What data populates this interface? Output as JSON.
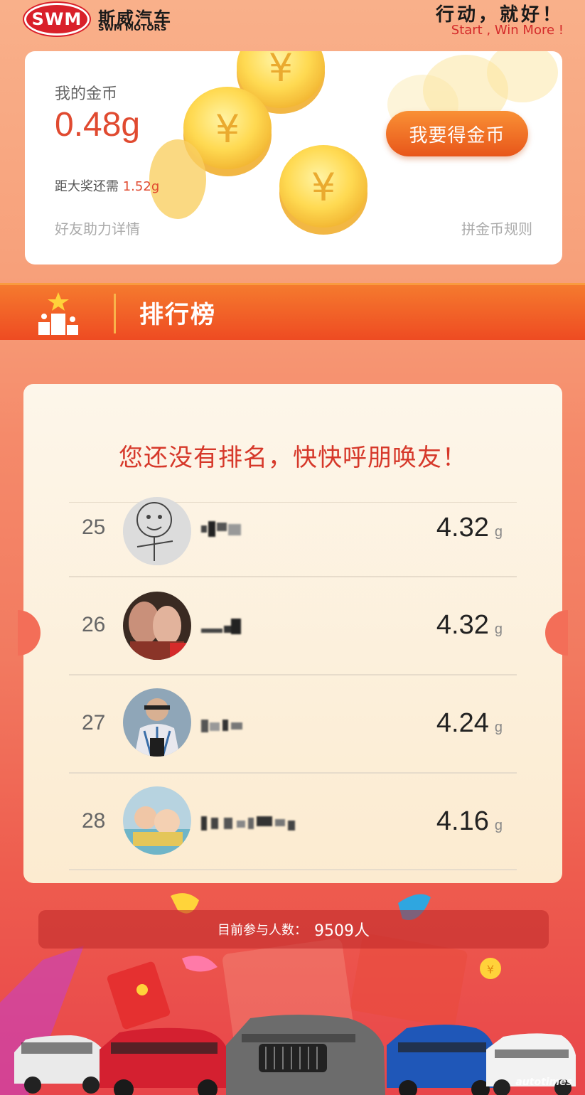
{
  "header": {
    "logo_badge": "SWM",
    "brand_cn": "斯威汽车",
    "brand_en": "SWM MOTORS",
    "slogan_cn": "行动，就好！",
    "slogan_en": "Start , Win More !"
  },
  "gold_card": {
    "label": "我的金币",
    "value": "0.48g",
    "remaining_label": "距大奖还需",
    "remaining_value": "1.52g",
    "get_gold_button": "我要得金币",
    "helpers_link": "好友助力详情",
    "rules_link": "拼金币规则"
  },
  "rank_header": {
    "title": "排行榜"
  },
  "board": {
    "message": "您还没有排名，快快呼朋唤友！",
    "unit": "g",
    "rows": [
      {
        "rank": "25",
        "score": "4.32"
      },
      {
        "rank": "26",
        "score": "4.32"
      },
      {
        "rank": "27",
        "score": "4.24"
      },
      {
        "rank": "28",
        "score": "4.16"
      }
    ]
  },
  "participants": {
    "label": "目前参与人数：",
    "count": "9509人"
  },
  "watermark": "autotimes",
  "colors": {
    "accent": "#e04a30",
    "button": "#f0701f",
    "rank_bar": "#ee4b22"
  }
}
